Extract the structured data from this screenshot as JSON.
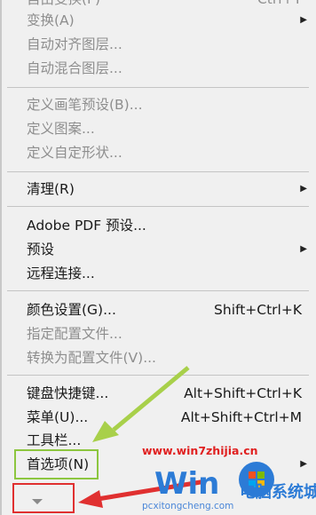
{
  "menu": {
    "top_partial": {
      "label": "自由变换(F)",
      "shortcut": "Ctrl+T"
    },
    "transform": {
      "label": "变换(A)"
    },
    "auto_align": {
      "label": "自动对齐图层..."
    },
    "auto_blend": {
      "label": "自动混合图层..."
    },
    "define_brush": {
      "label": "定义画笔预设(B)..."
    },
    "define_pattern": {
      "label": "定义图案..."
    },
    "define_shape": {
      "label": "定义自定形状..."
    },
    "purge": {
      "label": "清理(R)"
    },
    "pdf_presets": {
      "label": "Adobe PDF 预设..."
    },
    "presets": {
      "label": "预设"
    },
    "remote": {
      "label": "远程连接..."
    },
    "color_settings": {
      "label": "颜色设置(G)...",
      "shortcut": "Shift+Ctrl+K"
    },
    "assign_profile": {
      "label": "指定配置文件..."
    },
    "convert_profile": {
      "label": "转换为配置文件(V)..."
    },
    "keyboard_shortcuts": {
      "label": "键盘快捷键...",
      "shortcut": "Alt+Shift+Ctrl+K"
    },
    "menus": {
      "label": "菜单(U)...",
      "shortcut": "Alt+Shift+Ctrl+M"
    },
    "toolbar": {
      "label": "工具栏..."
    },
    "preferences": {
      "label": "首选项(N)"
    }
  },
  "watermark": {
    "url": "www.win7zhijia.cn",
    "brand": "电脑系统城",
    "site": "pcxitongcheng.com"
  },
  "colors": {
    "menu_bg": "#f0f0f0",
    "disabled_text": "#8e8e8e",
    "highlight_green": "#8cc63f",
    "callout_red": "#e03030"
  }
}
